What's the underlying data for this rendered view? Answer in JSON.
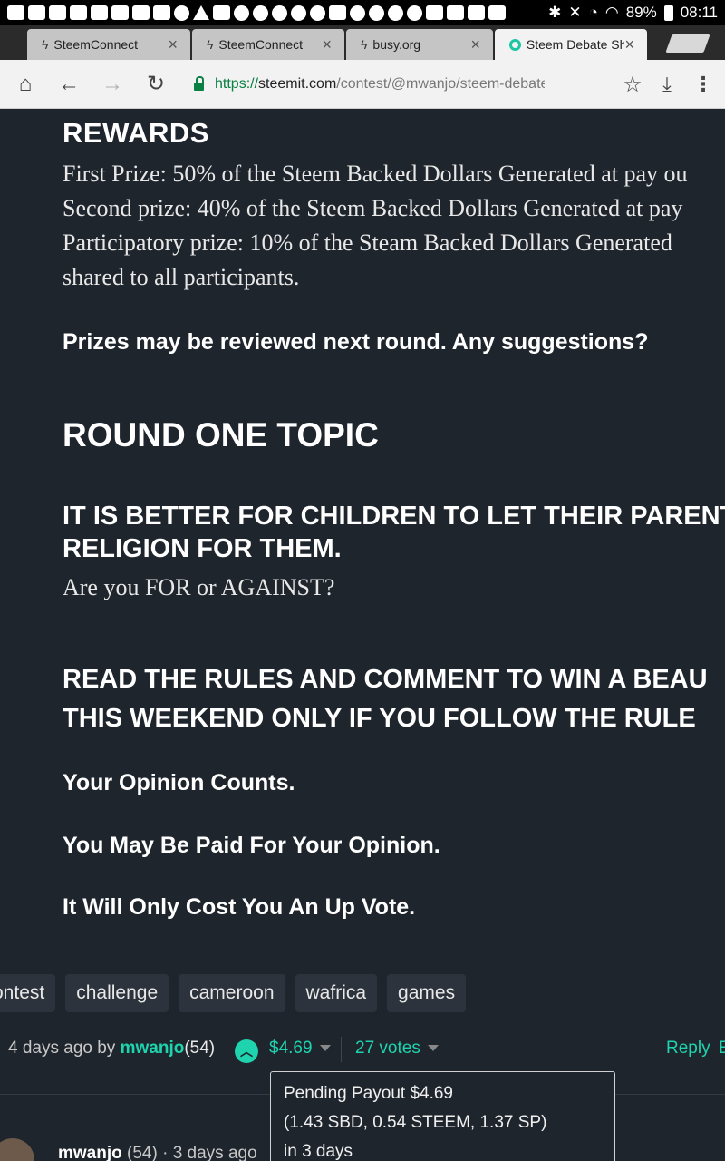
{
  "status_bar": {
    "battery": "89%",
    "time": "08:11"
  },
  "tabs": [
    {
      "label": "SteemConnect",
      "icon": "lightning-icon"
    },
    {
      "label": "SteemConnect",
      "icon": "lightning-icon"
    },
    {
      "label": "busy.org",
      "icon": "lightning-icon"
    },
    {
      "label": "Steem Debate Sh",
      "icon": "steemit-icon",
      "active": true
    }
  ],
  "url": {
    "scheme": "https://",
    "host": "steemit.com",
    "path": "/contest/@mwanjo/steem-debate-sharing"
  },
  "article": {
    "rewards_heading": "REWARDS",
    "rewards_lines": [
      "First Prize: 50% of the Steem Backed Dollars Generated at pay ou",
      "Second prize: 40% of the Steem Backed Dollars Generated at pay",
      "Participatory prize: 10% of the Steam Backed Dollars Generated",
      "shared to all participants."
    ],
    "prizes_note": "Prizes may be reviewed next round. Any suggestions?",
    "round_heading": "ROUND ONE TOPIC",
    "topic_lines": [
      "IT IS BETTER FOR CHILDREN TO LET THEIR PARENTS CH",
      "RELIGION FOR THEM."
    ],
    "topic_question": "Are you FOR or AGAINST?",
    "rules_lines": [
      "READ THE RULES AND COMMENT TO WIN A BEAU",
      "THIS WEEKEND ONLY IF YOU FOLLOW THE RULE"
    ],
    "opinion_counts": "Your Opinion Counts.",
    "paid_opinion": "You May Be Paid For Your Opinion.",
    "cost_upvote": "It Will Only Cost You An Up Vote."
  },
  "tags": [
    "ontest",
    "challenge",
    "cameroon",
    "wafrica",
    "games"
  ],
  "post_meta": {
    "age_prefix": "4 days ago by",
    "author": "mwanjo",
    "reputation": "(54)",
    "payout": "$4.69",
    "votes": "27 votes",
    "reply": "Reply",
    "edit_initial": "E"
  },
  "payout_popup": {
    "line1": "Pending Payout $4.69",
    "line2": "(1.43 SBD, 0.54 STEEM, 1.37 SP)",
    "line3": "in 3 days"
  },
  "comment": {
    "author": "mwanjo",
    "reputation": "(54)",
    "separator": "·",
    "age": "3 days ago"
  },
  "colors": {
    "background": "#1f252d",
    "accent": "#1ed3ad",
    "tag_bg": "#2c333c"
  }
}
